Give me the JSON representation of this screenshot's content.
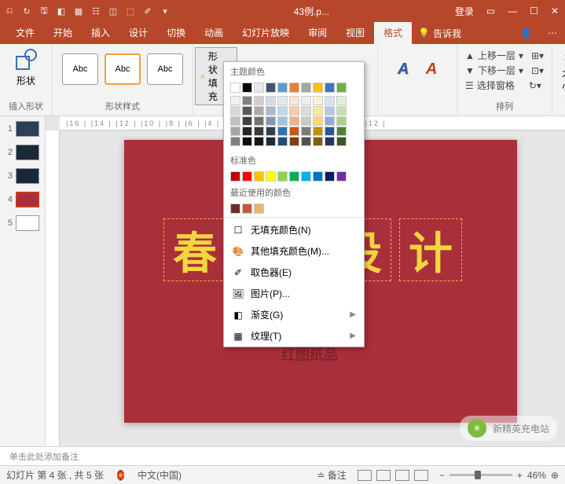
{
  "titlebar": {
    "filename": "43例.p...",
    "login": "登录",
    "qat": [
      "↶",
      "↷",
      "⎘",
      "◧",
      "▦",
      "☰",
      "◫",
      "⬚",
      "✎",
      "▤"
    ]
  },
  "tabs": {
    "items": [
      "文件",
      "开始",
      "插入",
      "设计",
      "切换",
      "动画",
      "幻灯片放映",
      "审阅",
      "视图",
      "格式"
    ],
    "active": "格式",
    "tell": "告诉我"
  },
  "ribbon": {
    "insert_shapes": {
      "label": "形状",
      "group": "插入形状"
    },
    "styles": {
      "abc": "Abc",
      "group": "形状样式",
      "fill_btn": "形状填充"
    },
    "wordart": {
      "a1": "A",
      "a2": "A"
    },
    "arrange": {
      "up": "上移一层",
      "down": "下移一层",
      "pane": "选择窗格",
      "group": "排列"
    },
    "size": {
      "label": "大小"
    }
  },
  "dropdown": {
    "theme": "主题颜色",
    "standard": "标准色",
    "recent": "最近使用的颜色",
    "nofill": "无填充颜色(N)",
    "more": "其他填充颜色(M)...",
    "eyedrop": "取色器(E)",
    "picture": "图片(P)...",
    "gradient": "渐变(G)",
    "texture": "纹理(T)",
    "theme_row1": [
      "#ffffff",
      "#000000",
      "#e7e6e6",
      "#44546a",
      "#5b9bd5",
      "#ed7d31",
      "#a5a5a5",
      "#ffc000",
      "#4472c4",
      "#70ad47"
    ],
    "theme_cols": [
      [
        "#f2f2f2",
        "#d9d9d9",
        "#bfbfbf",
        "#a6a6a6",
        "#808080"
      ],
      [
        "#808080",
        "#595959",
        "#404040",
        "#262626",
        "#0d0d0d"
      ],
      [
        "#d0cece",
        "#aeaaaa",
        "#757171",
        "#3a3838",
        "#161616"
      ],
      [
        "#d6dce5",
        "#adb9ca",
        "#8497b0",
        "#333f50",
        "#222a35"
      ],
      [
        "#deebf7",
        "#bdd7ee",
        "#9dc3e2",
        "#2e75b6",
        "#1f4e79"
      ],
      [
        "#fbe5d6",
        "#f8cbad",
        "#f4b183",
        "#c55a11",
        "#843c0c"
      ],
      [
        "#ededed",
        "#dbdbdb",
        "#c9c9c9",
        "#7b7b7b",
        "#525252"
      ],
      [
        "#fff2cc",
        "#ffe699",
        "#ffd966",
        "#bf9000",
        "#806000"
      ],
      [
        "#d9e2f3",
        "#b4c7e7",
        "#8faadc",
        "#2f5597",
        "#203864"
      ],
      [
        "#e2f0d9",
        "#c5e0b4",
        "#a9d18e",
        "#548235",
        "#385723"
      ]
    ],
    "standard_colors": [
      "#c00000",
      "#ff0000",
      "#ffc000",
      "#ffff00",
      "#92d050",
      "#00b050",
      "#00b0f0",
      "#0070c0",
      "#002060",
      "#7030a0"
    ],
    "recent_colors": [
      "#6d2a2a",
      "#c55a3a",
      "#e8b56a"
    ]
  },
  "slide": {
    "chars": [
      "春",
      "",
      "设",
      "计"
    ],
    "subtitle": "红图纸品"
  },
  "thumbnails": [
    {
      "n": "1",
      "bg": "#2a3f5a"
    },
    {
      "n": "2",
      "bg": "#1a2838"
    },
    {
      "n": "3",
      "bg": "#1a2838"
    },
    {
      "n": "4",
      "bg": "#a92f3a",
      "sel": true
    },
    {
      "n": "5",
      "bg": "#ffffff"
    }
  ],
  "notes": "单击此处添加备注",
  "status": {
    "slide": "幻灯片 第 4 张 , 共 5 张",
    "lang": "中文(中国)",
    "notes": "备注",
    "zoom": "46%"
  },
  "watermark": "新精英充电站"
}
